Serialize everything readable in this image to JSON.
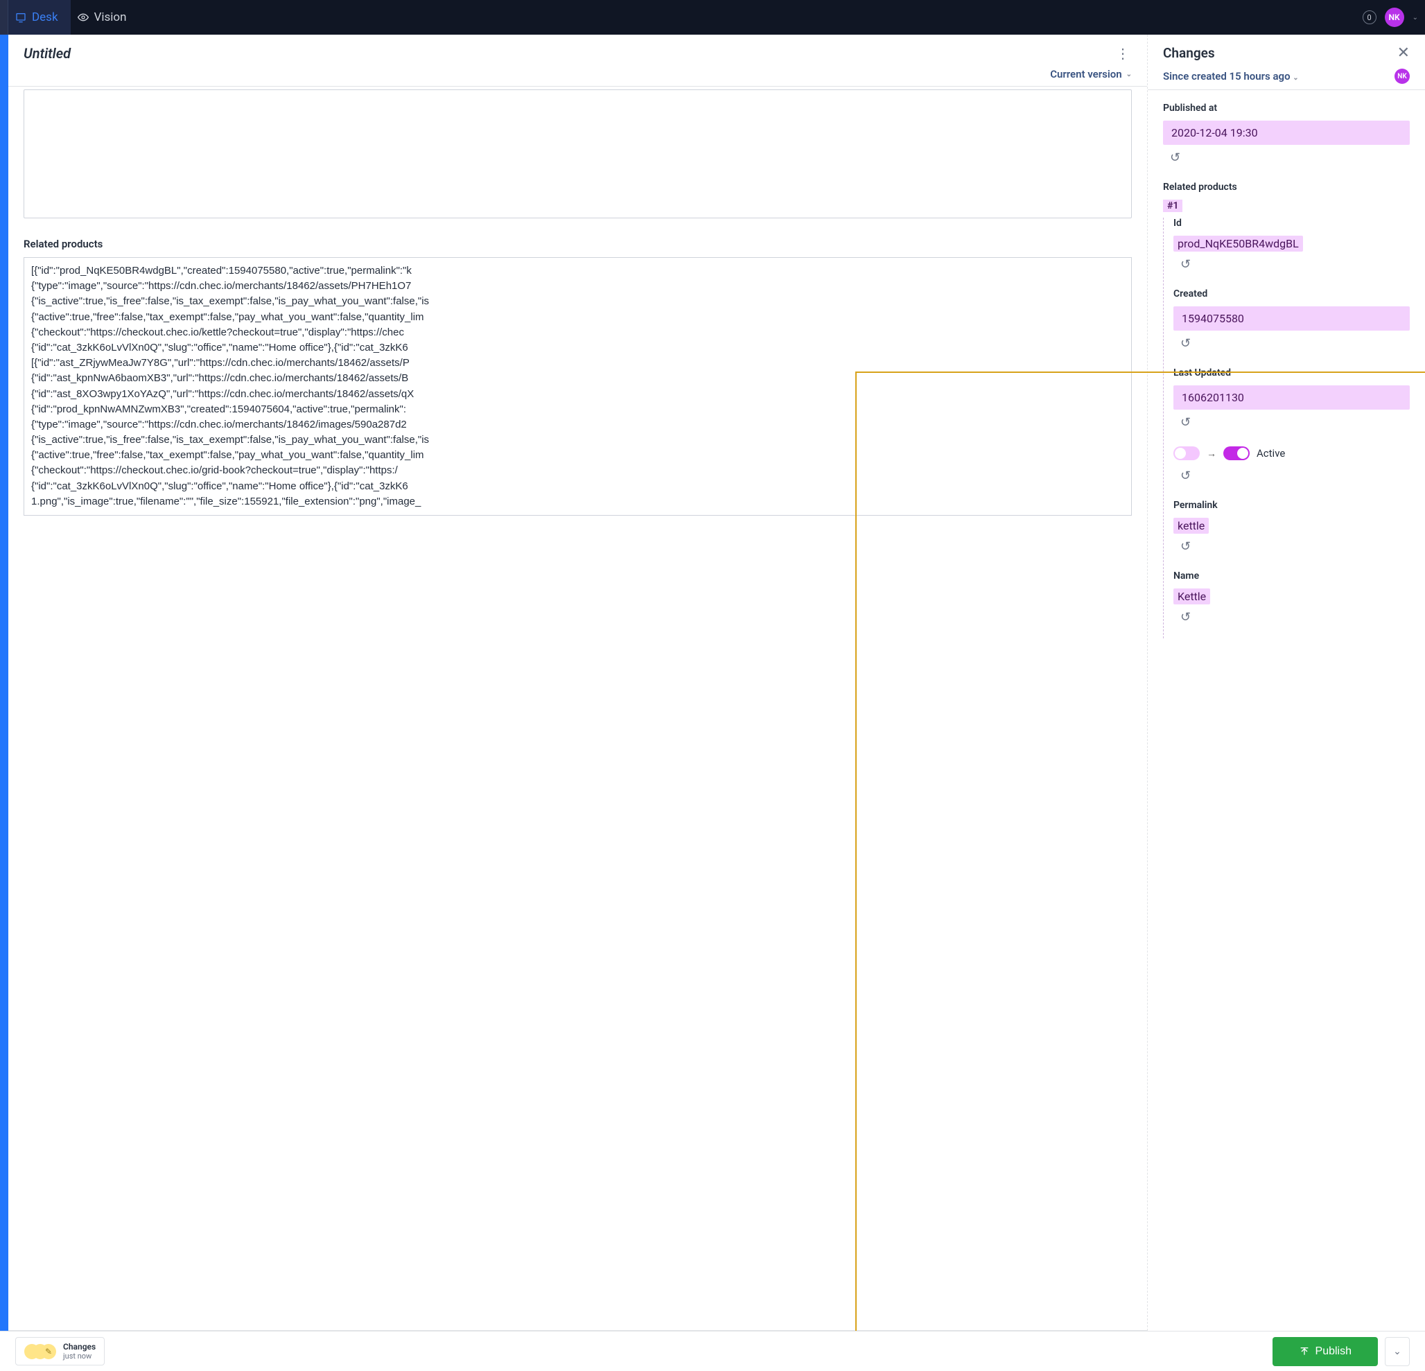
{
  "topbar": {
    "tab_desk": "Desk",
    "tab_vision": "Vision",
    "count": "0",
    "user_initials": "NK"
  },
  "editor": {
    "doc_title": "Untitled",
    "version_label": "Current version",
    "related_products_label": "Related products",
    "json_lines": [
      "[{\"id\":\"prod_NqKE50BR4wdgBL\",\"created\":1594075580,\"active\":true,\"permalink\":\"k",
      "{\"type\":\"image\",\"source\":\"https://cdn.chec.io/merchants/18462/assets/PH7HEh1O7",
      "{\"is_active\":true,\"is_free\":false,\"is_tax_exempt\":false,\"is_pay_what_you_want\":false,\"is",
      "{\"active\":true,\"free\":false,\"tax_exempt\":false,\"pay_what_you_want\":false,\"quantity_lim",
      "{\"checkout\":\"https://checkout.chec.io/kettle?checkout=true\",\"display\":\"https://chec",
      "{\"id\":\"cat_3zkK6oLvVlXn0Q\",\"slug\":\"office\",\"name\":\"Home office\"},{\"id\":\"cat_3zkK6",
      "[{\"id\":\"ast_ZRjywMeaJw7Y8G\",\"url\":\"https://cdn.chec.io/merchants/18462/assets/P",
      "{\"id\":\"ast_kpnNwA6baomXB3\",\"url\":\"https://cdn.chec.io/merchants/18462/assets/B",
      "{\"id\":\"ast_8XO3wpy1XoYAzQ\",\"url\":\"https://cdn.chec.io/merchants/18462/assets/qX",
      "{\"id\":\"prod_kpnNwAMNZwmXB3\",\"created\":1594075604,\"active\":true,\"permalink\":",
      "{\"type\":\"image\",\"source\":\"https://cdn.chec.io/merchants/18462/images/590a287d2",
      "{\"is_active\":true,\"is_free\":false,\"is_tax_exempt\":false,\"is_pay_what_you_want\":false,\"is",
      "{\"active\":true,\"free\":false,\"tax_exempt\":false,\"pay_what_you_want\":false,\"quantity_lim",
      "{\"checkout\":\"https://checkout.chec.io/grid-book?checkout=true\",\"display\":\"https:/",
      "{\"id\":\"cat_3zkK6oLvVlXn0Q\",\"slug\":\"office\",\"name\":\"Home office\"},{\"id\":\"cat_3zkK6",
      "1.png\",\"is_image\":true,\"filename\":\"\",\"file_size\":155921,\"file_extension\":\"png\",\"image_"
    ]
  },
  "changes": {
    "title": "Changes",
    "since_label": "Since created 15 hours ago",
    "avatar_initials": "NK",
    "published_at": {
      "label": "Published at",
      "value": "2020-12-04 19:30"
    },
    "related_products": {
      "label": "Related products",
      "item_tag": "#1",
      "id": {
        "label": "Id",
        "value": "prod_NqKE50BR4wdgBL"
      },
      "created": {
        "label": "Created",
        "value": "1594075580"
      },
      "last_updated": {
        "label": "Last Updated",
        "value": "1606201130"
      },
      "active": {
        "label": "Active"
      },
      "permalink": {
        "label": "Permalink",
        "value": "kettle"
      },
      "name": {
        "label": "Name",
        "value": "Kettle"
      }
    }
  },
  "footer": {
    "changes_label": "Changes",
    "changes_time": "just now",
    "publish_label": "Publish"
  }
}
